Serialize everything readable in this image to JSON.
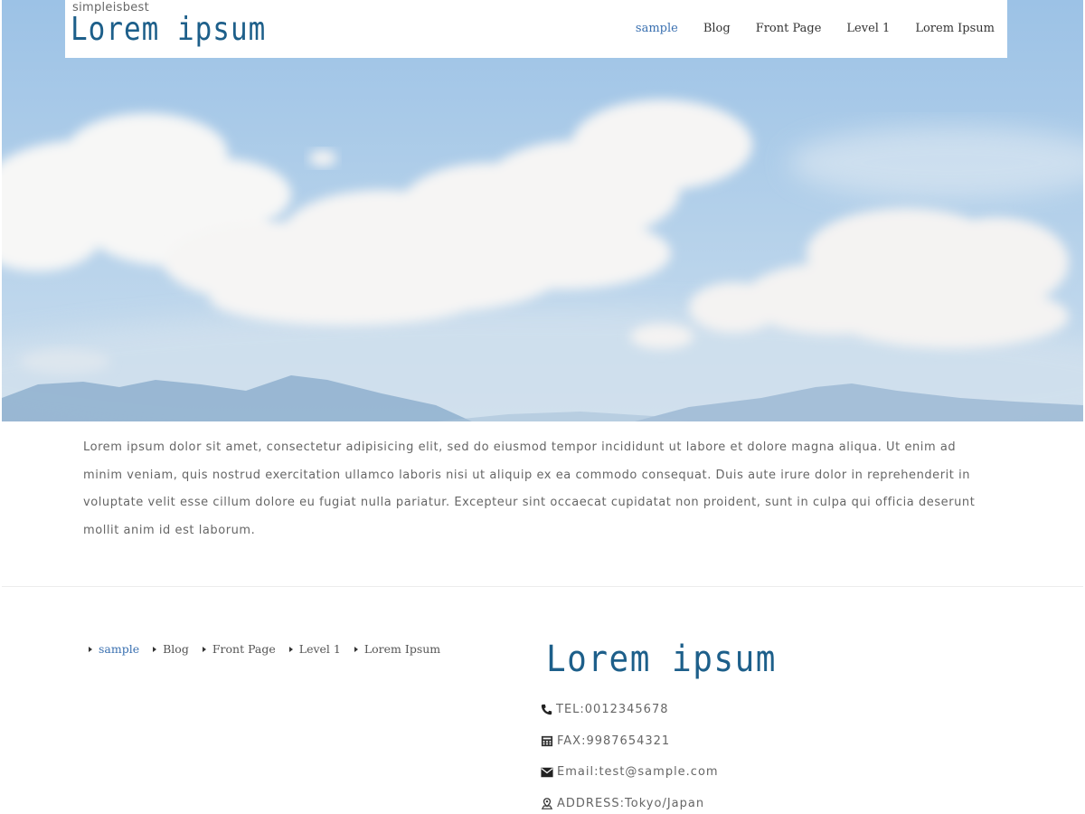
{
  "header": {
    "site_description": "simpleisbest",
    "site_title": "Lorem ipsum",
    "nav": [
      {
        "label": "sample",
        "active": true
      },
      {
        "label": "Blog",
        "active": false
      },
      {
        "label": "Front Page",
        "active": false
      },
      {
        "label": "Level 1",
        "active": false
      },
      {
        "label": "Lorem Ipsum",
        "active": false
      }
    ]
  },
  "intro": {
    "text": "Lorem ipsum dolor sit amet, consectetur adipisicing elit, sed do eiusmod tempor incididunt ut labore et dolore magna aliqua. Ut enim ad minim veniam, quis nostrud exercitation ullamco laboris nisi ut aliquip ex ea commodo consequat. Duis aute irure dolor in reprehenderit in voluptate velit esse cillum dolore eu fugiat nulla pariatur. Excepteur sint occaecat cupidatat non proident, sunt in culpa qui officia deserunt mollit anim id est laborum."
  },
  "footer": {
    "nav": [
      {
        "label": "sample",
        "active": true
      },
      {
        "label": "Blog",
        "active": false
      },
      {
        "label": "Front Page",
        "active": false
      },
      {
        "label": "Level 1",
        "active": false
      },
      {
        "label": "Lorem Ipsum",
        "active": false
      }
    ],
    "title": "Lorem ipsum",
    "contact": {
      "tel": "TEL:0012345678",
      "fax": "FAX:9987654321",
      "email": "Email:test@sample.com",
      "address": "ADDRESS:Tokyo/Japan"
    }
  },
  "colors": {
    "title": "#1d5f8a",
    "accent_link": "#3a70b0",
    "sky": "#9cc2e6"
  },
  "icons": [
    "phone-icon",
    "fax-icon",
    "envelope-icon",
    "map-pin-icon"
  ]
}
